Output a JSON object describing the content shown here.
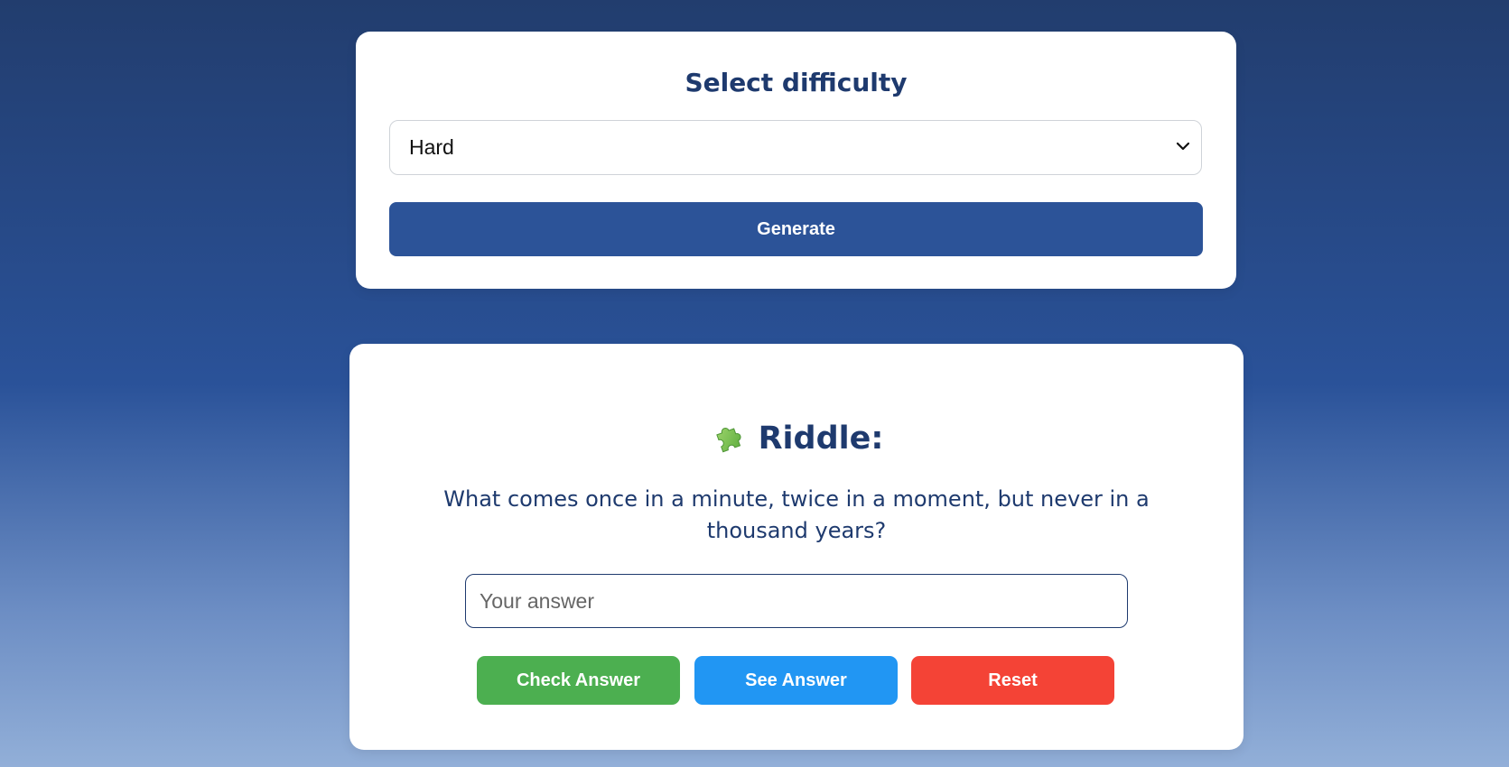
{
  "difficulty_card": {
    "title": "Select difficulty",
    "selected_difficulty": "Hard",
    "generate_label": "Generate"
  },
  "riddle_card": {
    "icon": "puzzle-icon",
    "title": "Riddle:",
    "question": "What comes once in a minute, twice in a moment, but never in a thousand years?",
    "answer_value": "",
    "answer_placeholder": "Your answer",
    "buttons": {
      "check_label": "Check Answer",
      "see_label": "See Answer",
      "reset_label": "Reset"
    }
  },
  "colors": {
    "accent": "#2c5398",
    "heading": "#1e3a6e",
    "check": "#4caf50",
    "see": "#2196f3",
    "reset": "#f44336"
  }
}
